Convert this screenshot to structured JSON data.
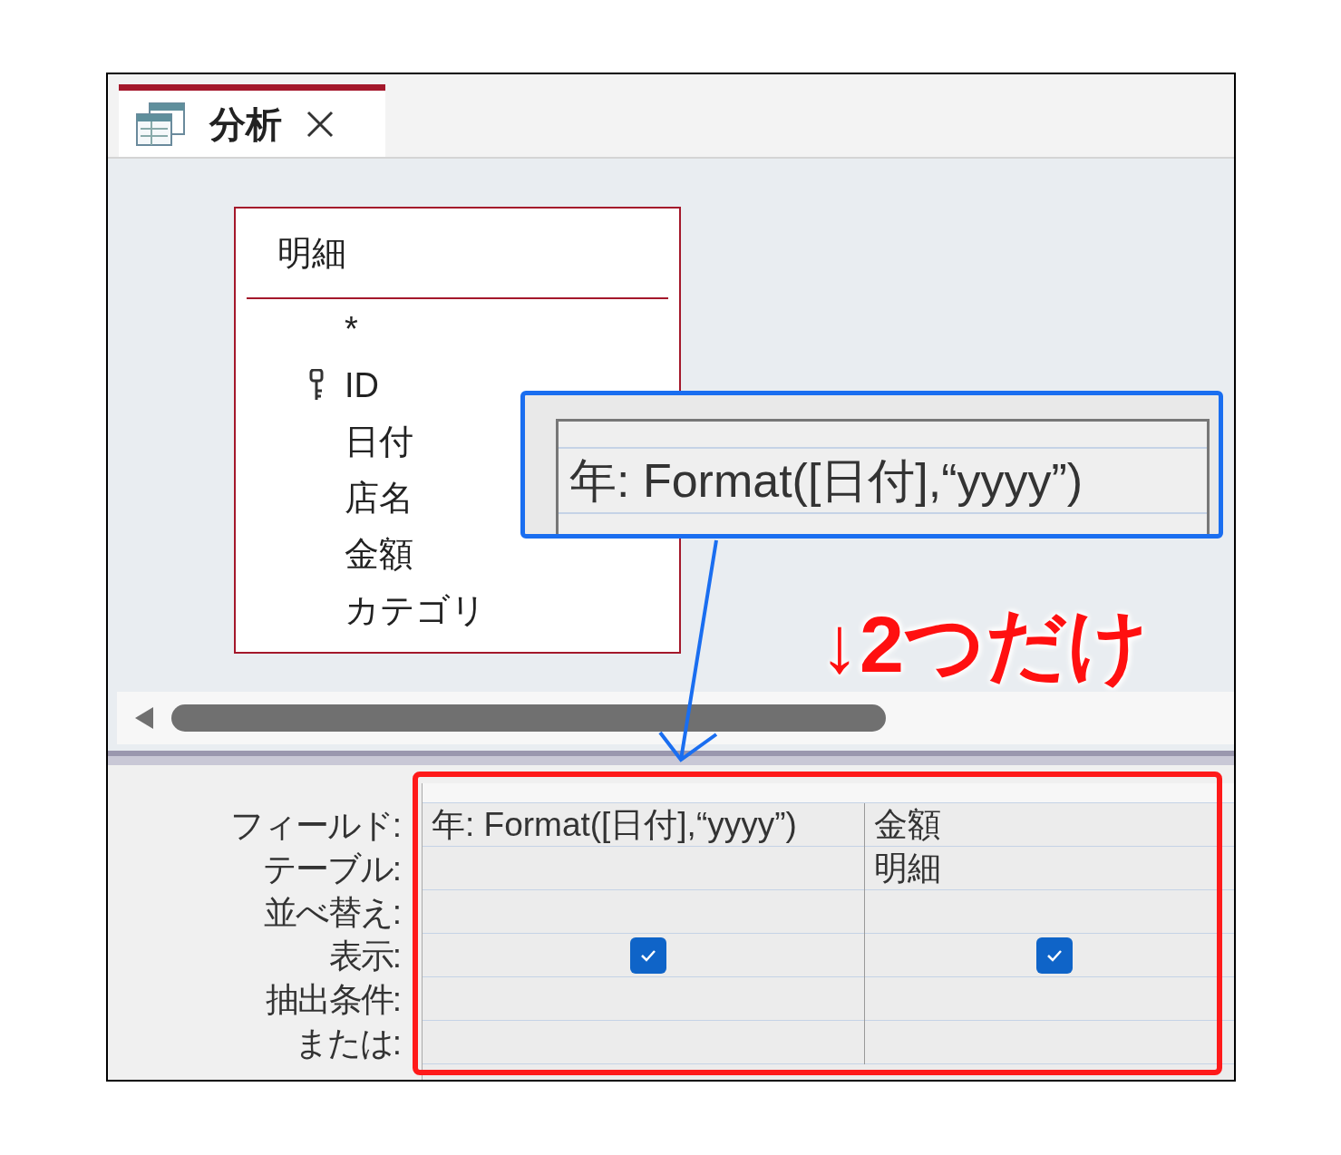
{
  "tab": {
    "label": "分析",
    "selected": true
  },
  "table_box": {
    "title": "明細",
    "fields": [
      {
        "name": "*",
        "primary_key": false
      },
      {
        "name": "ID",
        "primary_key": true
      },
      {
        "name": "日付",
        "primary_key": false
      },
      {
        "name": "店名",
        "primary_key": false
      },
      {
        "name": "金額",
        "primary_key": false
      },
      {
        "name": "カテゴリ",
        "primary_key": false
      }
    ]
  },
  "grid": {
    "row_labels": [
      "フィールド:",
      "テーブル:",
      "並べ替え:",
      "表示:",
      "抽出条件:",
      "または:"
    ],
    "columns": [
      {
        "field": "年: Format([日付],“yyyy”)",
        "show": true
      },
      {
        "field": "金額",
        "table": "明細",
        "show": true
      }
    ]
  },
  "callout": {
    "text": "年: Format([日付],“yyyy”)"
  },
  "annotation": {
    "text": "↓2つだけ"
  }
}
